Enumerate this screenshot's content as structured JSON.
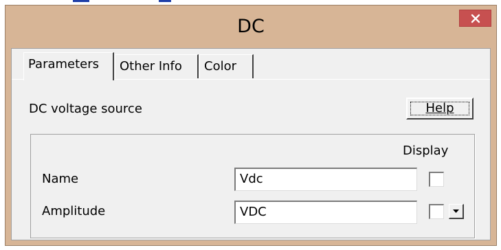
{
  "window": {
    "title": "DC",
    "close_icon": "close-icon"
  },
  "tabs": [
    {
      "label": "Parameters",
      "active": true
    },
    {
      "label": "Other Info",
      "active": false
    },
    {
      "label": "Color",
      "active": false
    }
  ],
  "panel": {
    "description": "DC voltage source",
    "help_label": "Help",
    "display_header": "Display",
    "fields": [
      {
        "label": "Name",
        "value": "Vdc",
        "display_checked": false
      },
      {
        "label": "Amplitude",
        "value": "VDC",
        "display_checked": false
      }
    ]
  },
  "colors": {
    "title_bar": "#d7b596",
    "close_button": "#c75050",
    "dialog_bg": "#f0f0f0"
  }
}
